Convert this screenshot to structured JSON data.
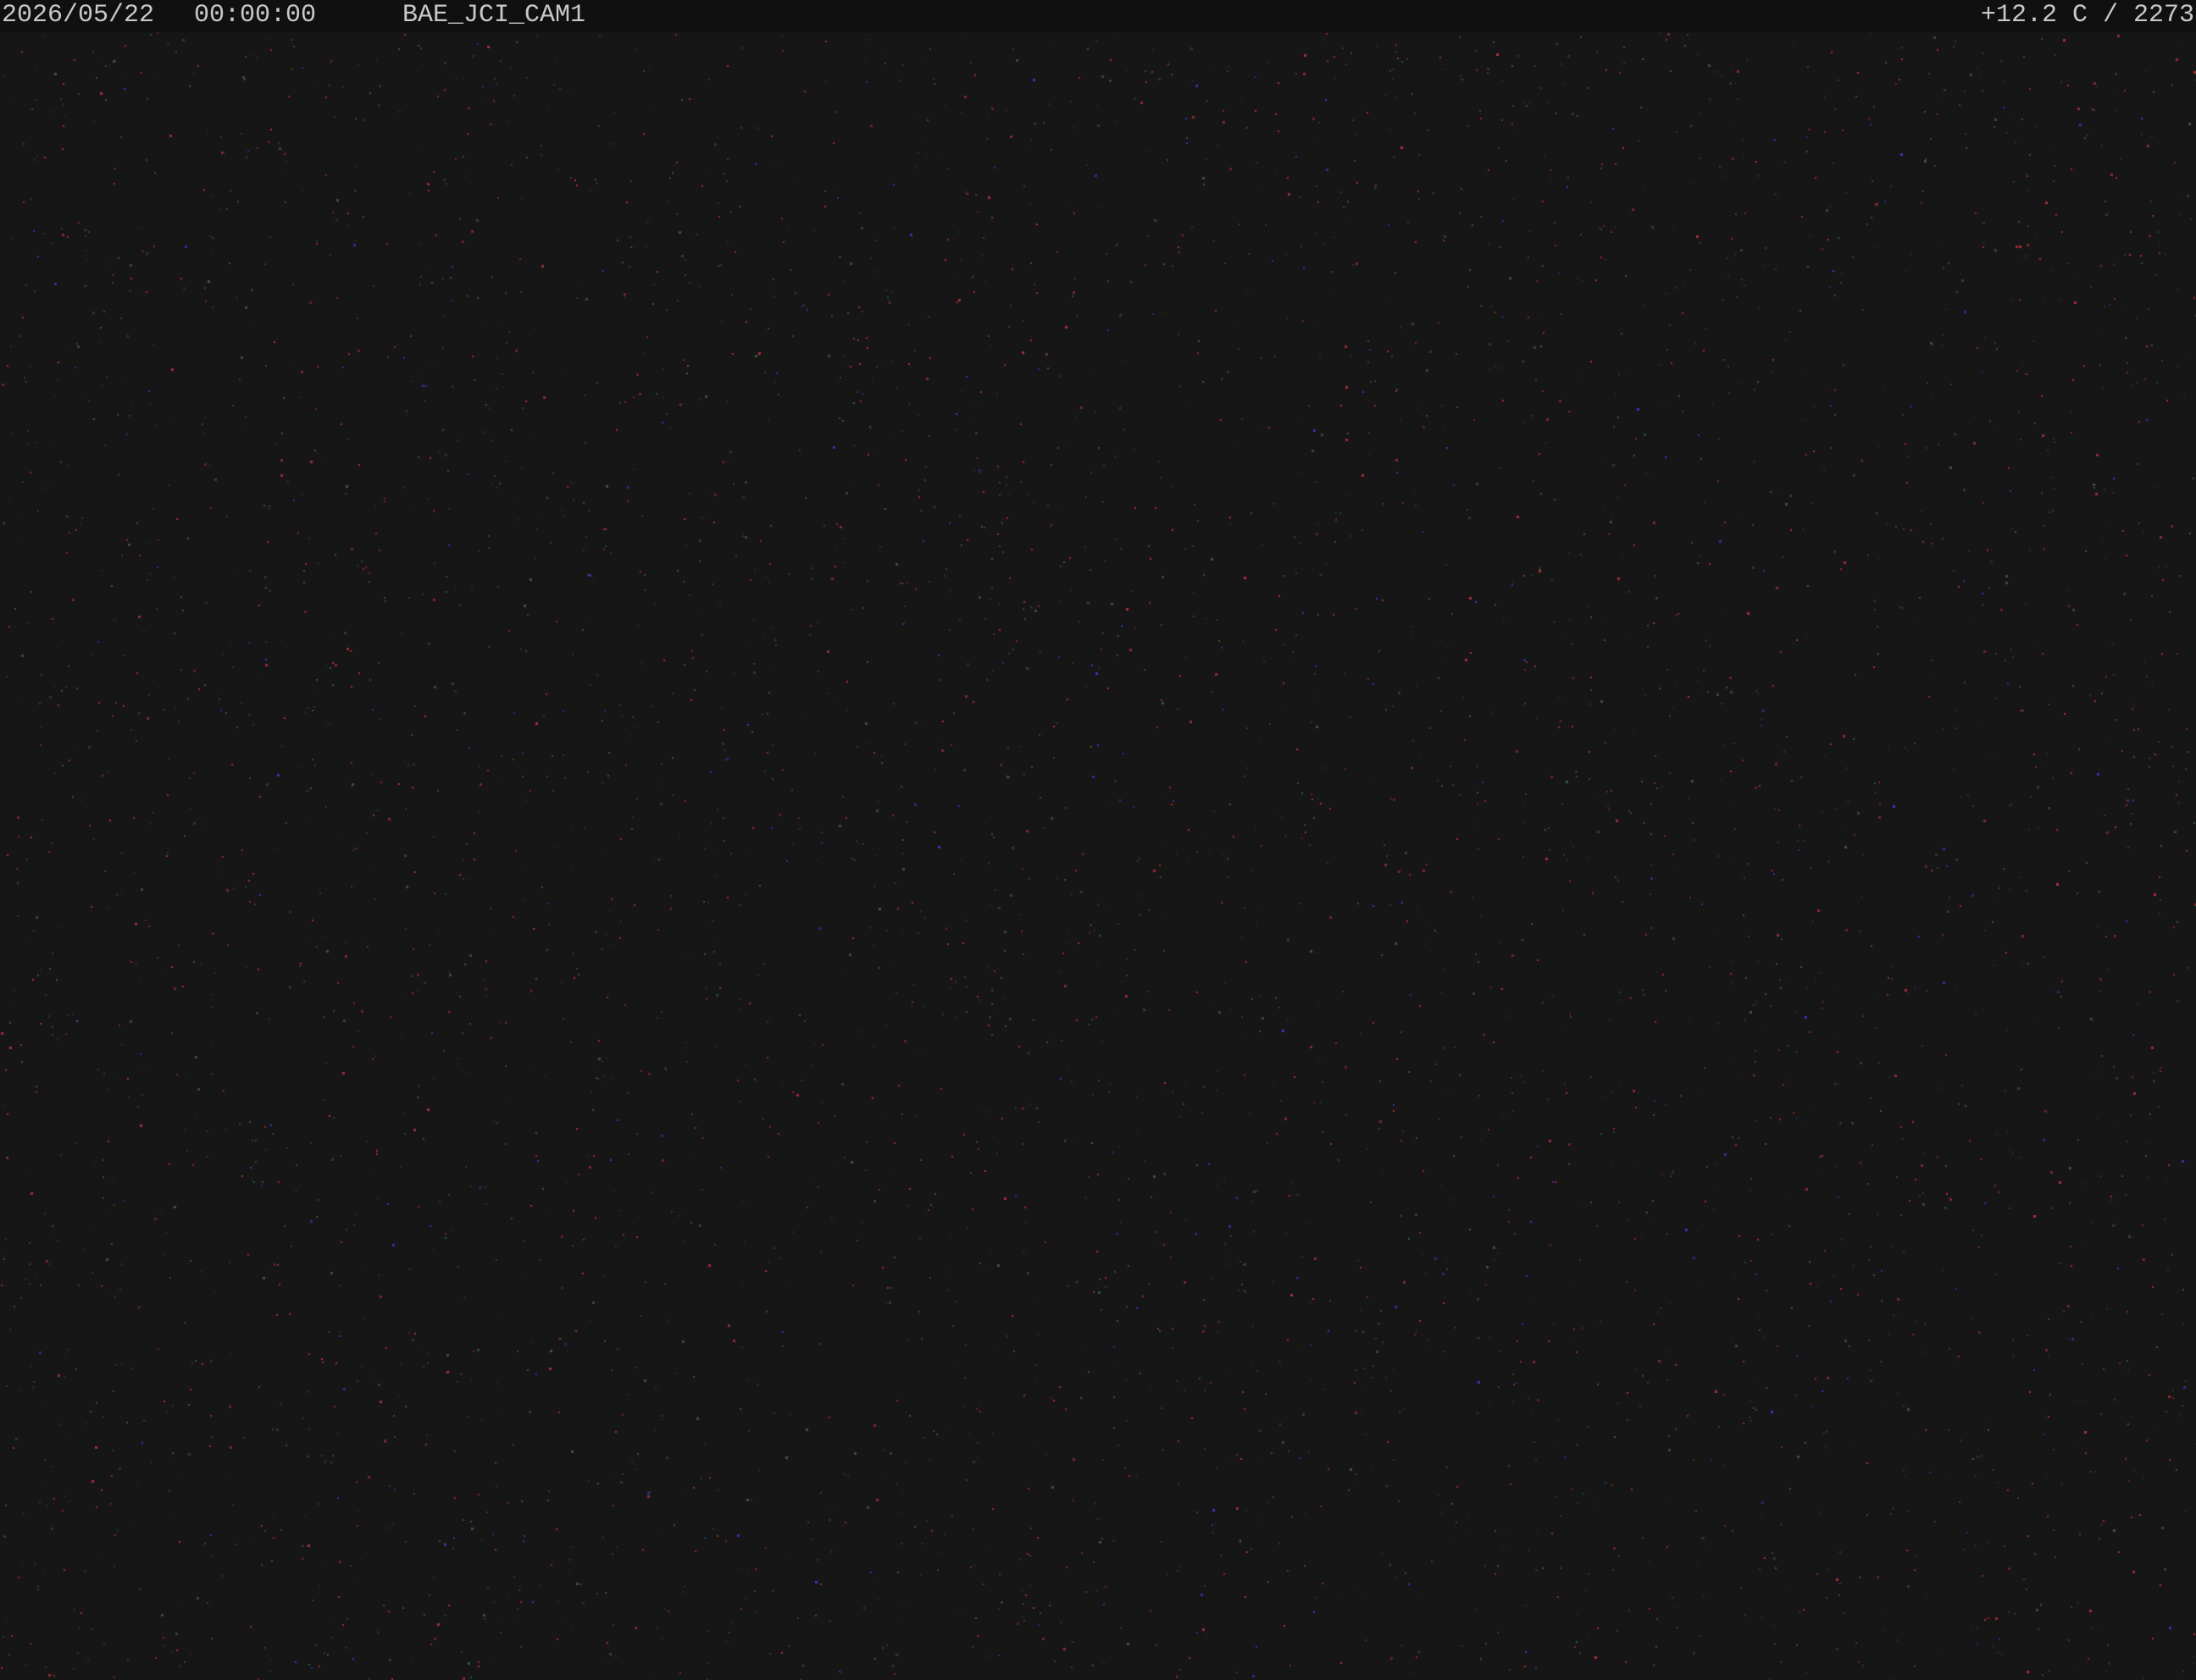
{
  "overlay": {
    "date": "2026/05/22",
    "time": "00:00:00",
    "camera_name": "BAE_JCI_CAM1",
    "status": "+12.2 C / 2273"
  },
  "colors": {
    "background": "#161616",
    "overlay_bar": "#101010",
    "overlay_text": "#c9c9c9",
    "sensor_noise_red": "#b3303a",
    "sensor_noise_green": "#3f5a3f",
    "sensor_noise_blue": "#3a3acb"
  }
}
